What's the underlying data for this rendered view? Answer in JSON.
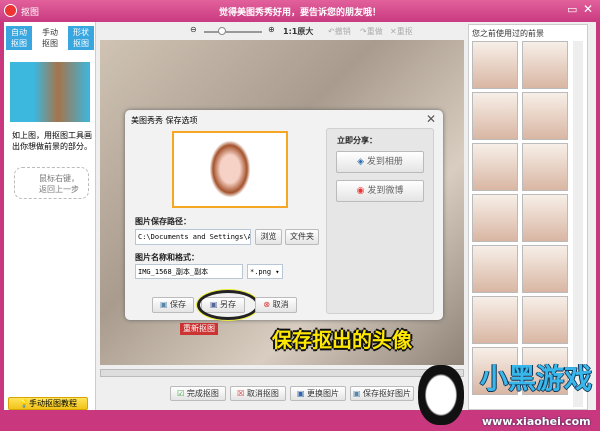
{
  "window": {
    "title": "抠图",
    "banner": "觉得美图秀秀好用，要告诉您的朋友哦！"
  },
  "left_panel": {
    "tabs": [
      "自动\n抠图",
      "手动\n抠图",
      "形状\n抠图"
    ],
    "instruction": "如上图，用抠图工具画出你想做前景的部分。",
    "hint": "鼠标右键，返回上一步",
    "tutorial_button": "手动抠图教程"
  },
  "toolbar": {
    "zoom_label": "1:1原大",
    "undo": "撤销",
    "redo": "重做",
    "reset": "重抠",
    "zoom_level": 0.25
  },
  "right_panel": {
    "title": "您之前使用过的前景"
  },
  "dialog": {
    "title": "美图秀秀 保存选项",
    "share_title": "立即分享：",
    "share_album": "发到相册",
    "share_weibo": "发到微博",
    "path_label": "图片保存路径：",
    "path_value": "C:\\Documents and Settings\\Ad",
    "browse": "浏览",
    "folder": "文件夹",
    "name_label": "图片名称和格式：",
    "name_value": "IMG_1568_副本_副本",
    "format": "*.png",
    "save": "保存",
    "save_as": "另存",
    "cancel": "取消"
  },
  "canvas": {
    "redo_button": "重新抠图"
  },
  "bottom": {
    "done": "完成抠图",
    "cancel": "取消抠图",
    "replace": "更换图片",
    "save": "保存抠好图片"
  },
  "annotation": "保存抠出的头像",
  "watermark": {
    "brand": "小黑游戏",
    "url": "www.xiaohei.com"
  }
}
